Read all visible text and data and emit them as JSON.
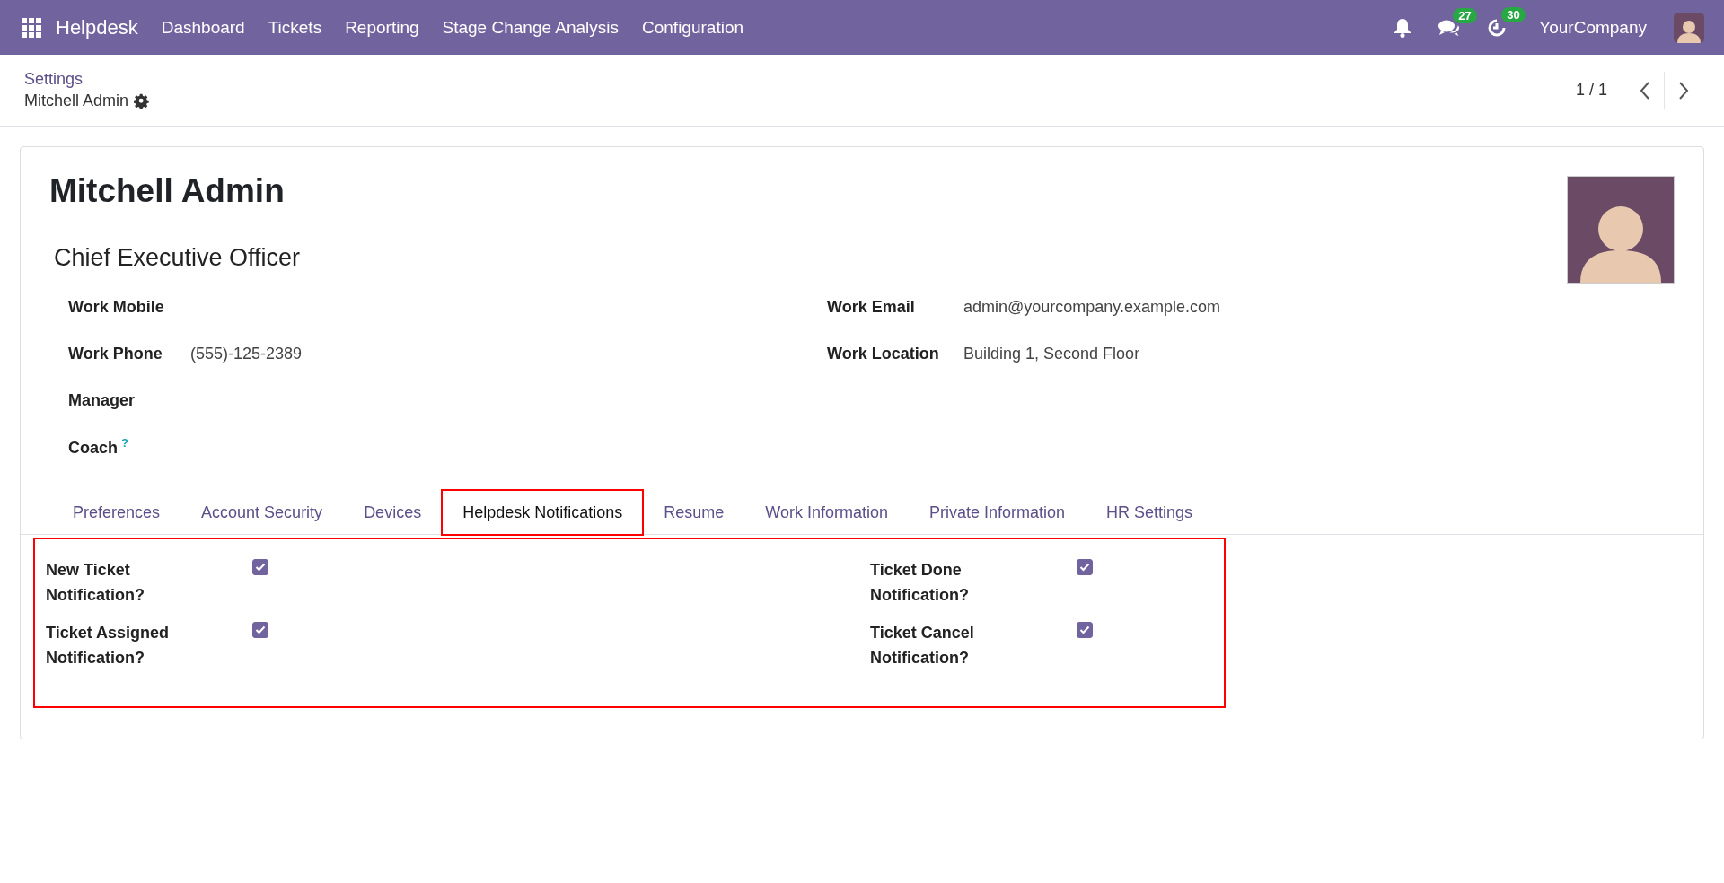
{
  "navbar": {
    "app_name": "Helpdesk",
    "menu": [
      "Dashboard",
      "Tickets",
      "Reporting",
      "Stage Change Analysis",
      "Configuration"
    ],
    "messages_count": "27",
    "activities_count": "30",
    "company": "YourCompany"
  },
  "breadcrumb": {
    "parent": "Settings",
    "current": "Mitchell Admin"
  },
  "pager": {
    "value": "1 / 1"
  },
  "form": {
    "name": "Mitchell Admin",
    "job_title": "Chief Executive Officer",
    "left_fields": [
      {
        "label": "Work Mobile"
      },
      {
        "label": "Work Phone",
        "value": "(555)-125-2389"
      },
      {
        "label": "Manager"
      },
      {
        "label": "Coach",
        "help": "?"
      }
    ],
    "right_fields": [
      {
        "label": "Work Email",
        "value": "admin@yourcompany.example.com"
      },
      {
        "label": "Work Location",
        "value": "Building 1, Second Floor"
      }
    ],
    "tabs": [
      {
        "label": "Preferences",
        "selected": false,
        "highlighted": false
      },
      {
        "label": "Account Security",
        "selected": false,
        "highlighted": false
      },
      {
        "label": "Devices",
        "selected": false,
        "highlighted": false
      },
      {
        "label": "Helpdesk Notifications",
        "selected": true,
        "highlighted": true
      },
      {
        "label": "Resume",
        "selected": false,
        "highlighted": false
      },
      {
        "label": "Work Information",
        "selected": false,
        "highlighted": false
      },
      {
        "label": "Private Information",
        "selected": false,
        "highlighted": false
      },
      {
        "label": "HR Settings",
        "selected": false,
        "highlighted": false
      }
    ],
    "notifications": {
      "highlighted": true,
      "left": [
        {
          "label": "New Ticket Notification?",
          "checked": true
        },
        {
          "label": "Ticket Assigned Notification?",
          "checked": true
        }
      ],
      "right": [
        {
          "label": "Ticket Done Notification?",
          "checked": true
        },
        {
          "label": "Ticket Cancel Notification?",
          "checked": true
        }
      ]
    }
  }
}
